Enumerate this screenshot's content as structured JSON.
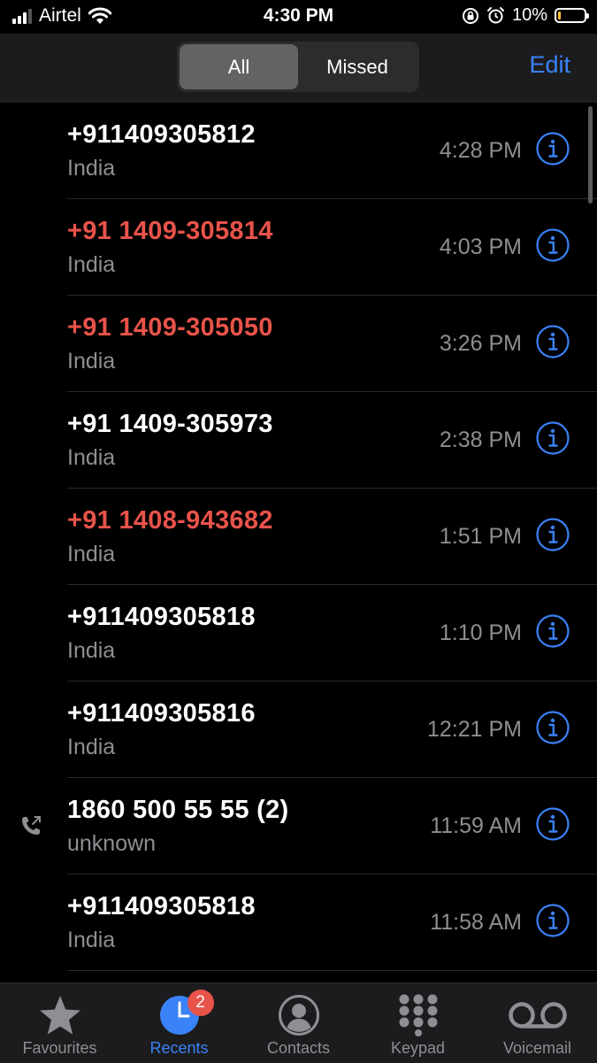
{
  "status_bar": {
    "carrier": "Airtel",
    "time": "4:30 PM",
    "battery_percent": "10%",
    "battery_level": 0.1,
    "icons": [
      "signal-icon",
      "wifi-icon",
      "orientation-lock-icon",
      "alarm-icon",
      "battery-icon"
    ]
  },
  "header": {
    "segments": [
      "All",
      "Missed"
    ],
    "selected_segment": "All",
    "edit_label": "Edit"
  },
  "calls": [
    {
      "number": "+911409305812",
      "subtitle": "India",
      "time": "4:28 PM",
      "missed": false,
      "outgoing": false
    },
    {
      "number": "+91 1409-305814",
      "subtitle": "India",
      "time": "4:03 PM",
      "missed": true,
      "outgoing": false
    },
    {
      "number": "+91 1409-305050",
      "subtitle": "India",
      "time": "3:26 PM",
      "missed": true,
      "outgoing": false
    },
    {
      "number": "+91 1409-305973",
      "subtitle": "India",
      "time": "2:38 PM",
      "missed": false,
      "outgoing": false
    },
    {
      "number": "+91 1408-943682",
      "subtitle": "India",
      "time": "1:51 PM",
      "missed": true,
      "outgoing": false
    },
    {
      "number": "+911409305818",
      "subtitle": "India",
      "time": "1:10 PM",
      "missed": false,
      "outgoing": false
    },
    {
      "number": "+911409305816",
      "subtitle": "India",
      "time": "12:21 PM",
      "missed": false,
      "outgoing": false
    },
    {
      "number": "1860 500 55 55 (2)",
      "subtitle": "unknown",
      "time": "11:59 AM",
      "missed": false,
      "outgoing": true
    },
    {
      "number": "+911409305818",
      "subtitle": "India",
      "time": "11:58 AM",
      "missed": false,
      "outgoing": false
    }
  ],
  "tab_bar": {
    "tabs": [
      {
        "label": "Favourites",
        "icon": "star-icon",
        "active": false
      },
      {
        "label": "Recents",
        "icon": "clock-icon",
        "active": true,
        "badge": "2"
      },
      {
        "label": "Contacts",
        "icon": "person-icon",
        "active": false
      },
      {
        "label": "Keypad",
        "icon": "keypad-icon",
        "active": false
      },
      {
        "label": "Voicemail",
        "icon": "voicemail-icon",
        "active": false
      }
    ]
  },
  "colors": {
    "accent": "#3a82f7",
    "missed": "#e8534a",
    "secondary_text": "#8e8e93",
    "background": "#000000",
    "bar_background": "#1c1c1e"
  }
}
